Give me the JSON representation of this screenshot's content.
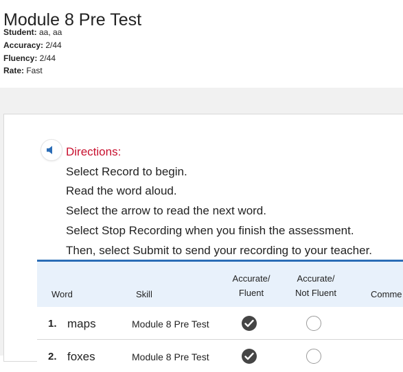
{
  "page": {
    "title": "Module 8 Pre Test"
  },
  "meta": {
    "student_label": "Student:",
    "student_value": " aa, aa",
    "accuracy_label": "Accuracy:",
    "accuracy_value": " 2/44",
    "fluency_label": "Fluency:",
    "fluency_value": " 2/44",
    "rate_label": "Rate:",
    "rate_value": " Fast"
  },
  "directions": {
    "title": "Directions:",
    "lines": [
      "Select Record to begin.",
      "Read the word aloud.",
      "Select the arrow to read the next word.",
      "Select Stop Recording when you finish the assessment.",
      "Then, select Submit to send your recording to your teacher."
    ]
  },
  "table": {
    "headers": {
      "word": "Word",
      "skill": "Skill",
      "accurate_fluent_1": "Accurate/",
      "accurate_fluent_2": "Fluent",
      "accurate_not_fluent_1": "Accurate/",
      "accurate_not_fluent_2": "Not Fluent",
      "comments": "Comme"
    },
    "rows": [
      {
        "num": "1.",
        "word": "maps",
        "skill": "Module 8 Pre Test",
        "accurate_fluent": true,
        "accurate_not_fluent": false
      },
      {
        "num": "2.",
        "word": "foxes",
        "skill": "Module 8 Pre Test",
        "accurate_fluent": true,
        "accurate_not_fluent": false
      }
    ]
  },
  "colors": {
    "directions_title": "#c8102e",
    "table_top_border": "#2a6cb6",
    "header_bg": "#e8f1fb",
    "speaker_icon": "#2a6cb6"
  },
  "icons": {
    "speaker": "speaker-icon",
    "check": "checkmark-icon"
  }
}
